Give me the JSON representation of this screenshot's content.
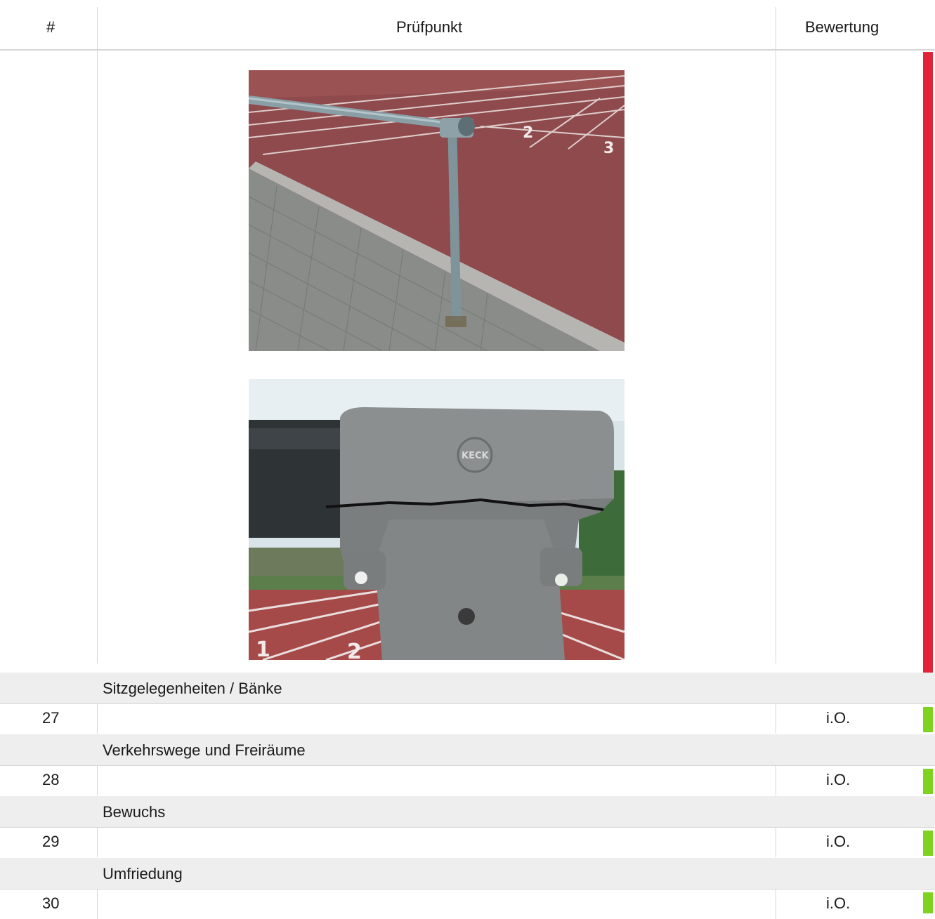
{
  "header": {
    "col_num": "#",
    "col_item": "Prüfpunkt",
    "col_rating": "Bewertung"
  },
  "photos": [
    {
      "icon": "photo-railing-track",
      "description": "Geländer an Laufbahn"
    },
    {
      "icon": "photo-cracked-fitting",
      "description": "Gerissener Rohrverbinder",
      "stamp_text": "KECK"
    }
  ],
  "colors": {
    "defect": "#e0243a",
    "ok": "#7ed321",
    "section_bg": "#eeeeee"
  },
  "sections": [
    {
      "title": "Sitzgelegenheiten / Bänke",
      "row": {
        "num": "27",
        "item": "",
        "rating": "i.O."
      }
    },
    {
      "title": "Verkehrswege und Freiräume",
      "row": {
        "num": "28",
        "item": "",
        "rating": "i.O."
      }
    },
    {
      "title": "Bewuchs",
      "row": {
        "num": "29",
        "item": "",
        "rating": "i.O."
      }
    },
    {
      "title": "Umfriedung",
      "row": {
        "num": "30",
        "item": "",
        "rating": "i.O."
      }
    }
  ]
}
